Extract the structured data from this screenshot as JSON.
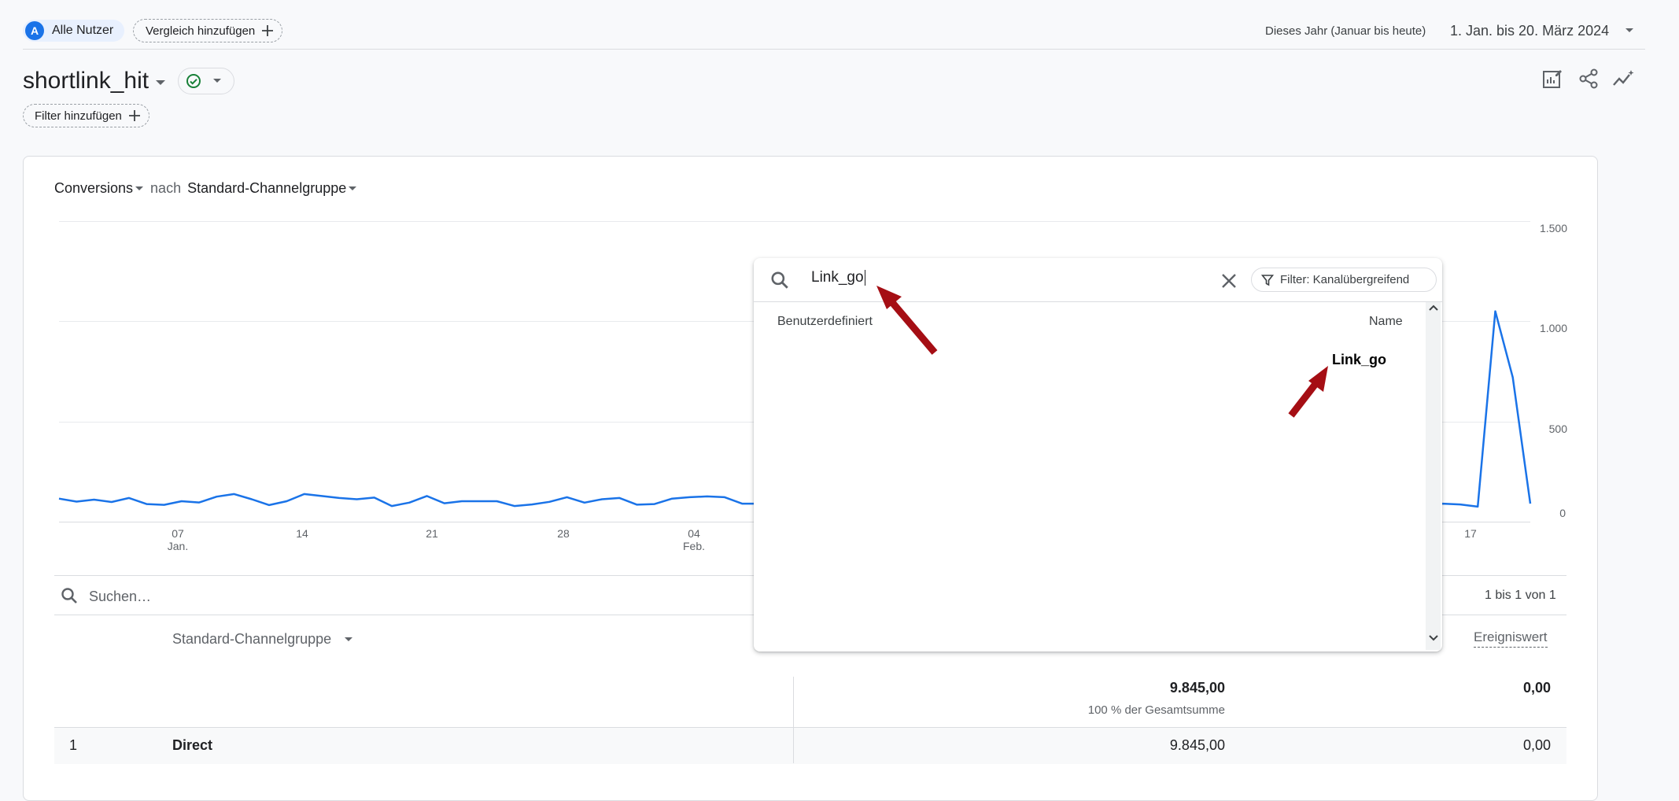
{
  "header": {
    "user_chip": {
      "avatar_letter": "A",
      "label": "Alle Nutzer"
    },
    "compare_chip": {
      "label": "Vergleich hinzufügen"
    },
    "date_preset": "Dieses Jahr (Januar bis heute)",
    "date_range": "1. Jan. bis 20. März 2024"
  },
  "report": {
    "title": "shortlink_hit",
    "filter_chip": {
      "label": "Filter hinzufügen"
    },
    "toolbar": {
      "icons": [
        "edit-report-icon",
        "share-icon",
        "insights-icon"
      ]
    }
  },
  "card": {
    "metric": "Conversions",
    "connector": "nach",
    "dimension": "Standard-Channelgruppe",
    "chart_data": {
      "type": "line",
      "ylim": [
        0,
        1500
      ],
      "yticks": [
        "1.500",
        "1.000",
        "500",
        "0"
      ],
      "xticks": [
        {
          "day": "07",
          "month": "Jan."
        },
        {
          "day": "14",
          "month": ""
        },
        {
          "day": "21",
          "month": ""
        },
        {
          "day": "28",
          "month": ""
        },
        {
          "day": "04",
          "month": "Feb."
        },
        {
          "day": "17",
          "month": ""
        }
      ],
      "series": [
        {
          "color": "#1a73e8",
          "values": [
            115,
            100,
            110,
            98,
            118,
            88,
            84,
            102,
            96,
            125,
            138,
            112,
            83,
            102,
            138,
            128,
            118,
            112,
            120,
            78,
            95,
            128,
            92,
            102,
            102,
            102,
            78,
            86,
            99,
            122,
            95,
            112,
            118,
            85,
            88,
            115,
            122,
            126,
            122,
            90,
            90,
            90,
            90,
            90,
            90,
            90,
            90,
            90,
            90,
            90,
            90,
            90,
            90,
            90,
            90,
            90,
            90,
            90,
            90,
            90,
            90,
            90,
            90,
            90,
            90,
            90,
            90,
            90,
            90,
            90,
            90,
            90,
            90,
            90,
            90,
            90,
            90,
            90,
            88,
            90,
            86,
            75,
            1050,
            720,
            90
          ]
        }
      ]
    },
    "table": {
      "search_placeholder": "Suchen…",
      "pagination": "1 bis 1 von 1",
      "dimension_header": "Standard-Channelgruppe",
      "value_header": "Ereigniswert",
      "totals": {
        "conversions": "9.845,00",
        "share": "100 % der Gesamtsumme",
        "value": "0,00"
      },
      "rows": [
        {
          "index": "1",
          "channel": "Direct",
          "conversions": "9.845,00",
          "value": "0,00"
        }
      ]
    }
  },
  "popup": {
    "search_value": "Link_go",
    "filter_label": "Filter: Kanalübergreifend",
    "col_custom": "Benutzerdefiniert",
    "col_name": "Name",
    "results": [
      "Link_go"
    ],
    "annotation_color": "#a50e14"
  }
}
